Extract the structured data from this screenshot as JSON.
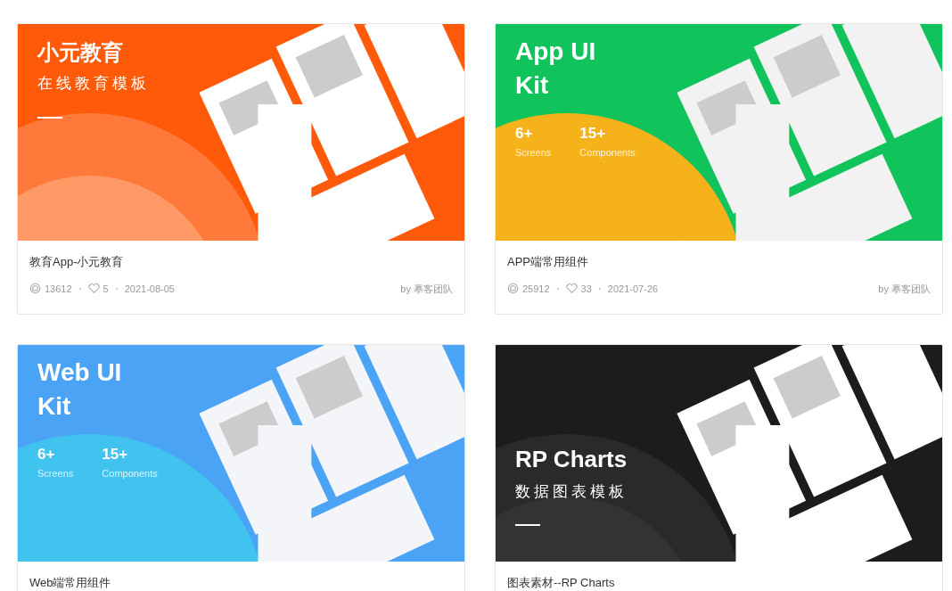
{
  "cards": [
    {
      "cover": {
        "kind": "edu",
        "title": "小元教育",
        "subtitle": "在线教育模板"
      },
      "title": "教育App-小元教育",
      "meta": {
        "views": "13612",
        "likes": "5",
        "date": "2021-08-05",
        "author": "by 摹客团队"
      }
    },
    {
      "cover": {
        "kind": "app",
        "title_lines": [
          "App UI",
          "Kit"
        ],
        "stats": [
          {
            "value": "6+",
            "label": "Screens"
          },
          {
            "value": "15+",
            "label": "Components"
          }
        ]
      },
      "title": "APP端常用组件",
      "meta": {
        "views": "25912",
        "likes": "33",
        "date": "2021-07-26",
        "author": "by 摹客团队"
      }
    },
    {
      "cover": {
        "kind": "web",
        "title_lines": [
          "Web UI",
          "Kit"
        ],
        "stats": [
          {
            "value": "6+",
            "label": "Screens"
          },
          {
            "value": "15+",
            "label": "Components"
          }
        ]
      },
      "title": "Web端常用组件"
    },
    {
      "cover": {
        "kind": "charts",
        "title": "RP Charts",
        "subtitle": "数据图表模板"
      },
      "title": "图表素材--RP Charts"
    }
  ]
}
